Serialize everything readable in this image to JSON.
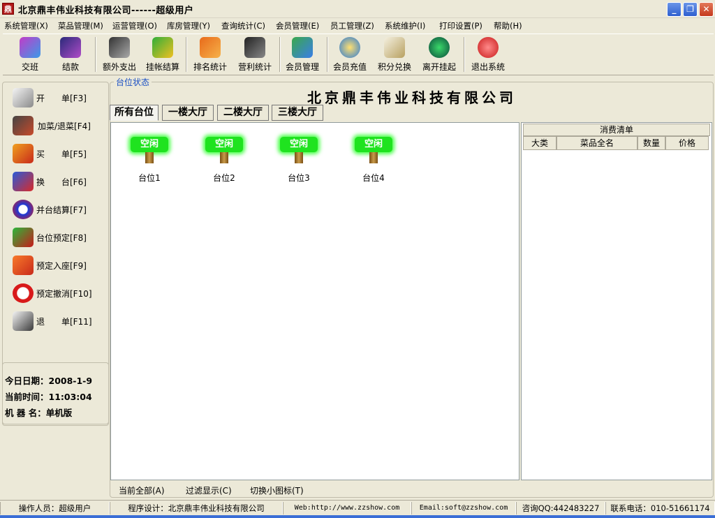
{
  "window": {
    "app_icon_text": "鼎",
    "title": "北京鼎丰伟业科技有限公司------超级用户",
    "controls": {
      "minimize": "_",
      "restore": "❐",
      "close": "✕"
    }
  },
  "menu": [
    "系统管理(X)",
    "菜品管理(M)",
    "运营管理(O)",
    "库房管理(Y)",
    "查询统计(C)",
    "会员管理(E)",
    "员工管理(Z)",
    "系统维护(I)",
    "打印设置(P)",
    "帮助(H)"
  ],
  "toolbar": [
    {
      "label": "交班",
      "icon": "users-icon"
    },
    {
      "label": "结款",
      "icon": "cash-icon"
    },
    {
      "label": "额外支出",
      "icon": "pen-icon"
    },
    {
      "label": "挂帐结算",
      "icon": "card-icon"
    },
    {
      "label": "排名统计",
      "icon": "person-icon"
    },
    {
      "label": "营利统计",
      "icon": "device-icon"
    },
    {
      "label": "会员管理",
      "icon": "members-icon"
    },
    {
      "label": "会员充值",
      "icon": "recharge-icon"
    },
    {
      "label": "积分兑换",
      "icon": "points-icon"
    },
    {
      "label": "离开挂起",
      "icon": "hourglass-icon"
    },
    {
      "label": "退出系统",
      "icon": "power-icon"
    }
  ],
  "sidebar": [
    {
      "label": "开　　单[F3]",
      "icon": "open-order-icon"
    },
    {
      "label": "加菜/退菜[F4]",
      "icon": "add-dish-icon"
    },
    {
      "label": "买　　单[F5]",
      "icon": "checkout-icon"
    },
    {
      "label": "换　　台[F6]",
      "icon": "switch-table-icon"
    },
    {
      "label": "并台结算[F7]",
      "icon": "merge-table-icon"
    },
    {
      "label": "台位预定[F8]",
      "icon": "reserve-icon"
    },
    {
      "label": "预定入座[F9]",
      "icon": "seat-icon"
    },
    {
      "label": "预定撤消[F10]",
      "icon": "cancel-reserve-icon"
    },
    {
      "label": "退　　单[F11]",
      "icon": "refund-icon"
    }
  ],
  "info": {
    "date": "今日日期：2008-1-9",
    "time": "当前时间：11:03:04",
    "machine": "机 器 名：单机版"
  },
  "main": {
    "group_caption": "台位状态",
    "company_heading": "北京鼎丰伟业科技有限公司",
    "tabs": [
      "所有台位",
      "一楼大厅",
      "二楼大厅",
      "三楼大厅"
    ],
    "active_tab": 0,
    "tables": [
      {
        "status": "空闲",
        "name": "台位1"
      },
      {
        "status": "空闲",
        "name": "台位2"
      },
      {
        "status": "空闲",
        "name": "台位3"
      },
      {
        "status": "空闲",
        "name": "台位4"
      }
    ]
  },
  "bill": {
    "title": "消费清单",
    "columns": [
      "大类",
      "菜品全名",
      "数量",
      "价格"
    ]
  },
  "bottom_actions": [
    "当前全部(A)",
    "过滤显示(C)",
    "切换小图标(T)"
  ],
  "status_bar": [
    "操作人员：超级用户",
    "程序设计：北京鼎丰伟业科技有限公司",
    "Web:http://www.zzshow.com",
    "Email:soft@zzshow.com",
    "咨询QQ:442483227",
    "联系电话：010-51661174"
  ],
  "colors": {
    "status_free": "#1fe31f",
    "caption_blue": "#1a4fc4",
    "window_bg": "#ece9d8"
  }
}
